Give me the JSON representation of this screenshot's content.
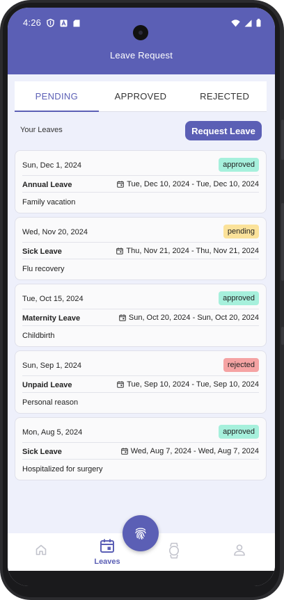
{
  "status_bar": {
    "time": "4:26",
    "left_icons": [
      "shield-icon",
      "a-box-icon",
      "sd-card-icon"
    ],
    "right_icons": [
      "wifi-icon",
      "signal-icon",
      "battery-icon"
    ]
  },
  "header": {
    "title": "Leave Request"
  },
  "tabs": [
    {
      "label": "PENDING",
      "active": true
    },
    {
      "label": "APPROVED",
      "active": false
    },
    {
      "label": "REJECTED",
      "active": false
    }
  ],
  "toolbar": {
    "section_label": "Your Leaves",
    "request_button": "Request Leave"
  },
  "status_colors": {
    "approved": "#a6f0dc",
    "pending": "#fbe29a",
    "rejected": "#f5a3a3"
  },
  "leaves": [
    {
      "date": "Sun, Dec 1, 2024",
      "status": "approved",
      "type": "Annual Leave",
      "range": "Tue, Dec 10, 2024 - Tue, Dec 10, 2024",
      "reason": "Family vacation"
    },
    {
      "date": "Wed, Nov 20, 2024",
      "status": "pending",
      "type": "Sick Leave",
      "range": "Thu, Nov 21, 2024 - Thu, Nov 21, 2024",
      "reason": "Flu recovery"
    },
    {
      "date": "Tue, Oct 15, 2024",
      "status": "approved",
      "type": "Maternity Leave",
      "range": "Sun, Oct 20, 2024 - Sun, Oct 20, 2024",
      "reason": "Childbirth"
    },
    {
      "date": "Sun, Sep 1, 2024",
      "status": "rejected",
      "type": "Unpaid Leave",
      "range": "Tue, Sep 10, 2024 - Tue, Sep 10, 2024",
      "reason": "Personal reason"
    },
    {
      "date": "Mon, Aug 5, 2024",
      "status": "approved",
      "type": "Sick Leave",
      "range": "Wed, Aug 7, 2024 - Wed, Aug 7, 2024",
      "reason": "Hospitalized for surgery"
    }
  ],
  "bottom_nav": {
    "items": [
      {
        "icon": "home-icon",
        "label": "",
        "active": false
      },
      {
        "icon": "calendar-icon",
        "label": "Leaves",
        "active": true
      },
      {
        "icon": "watch-icon",
        "label": "",
        "active": false
      },
      {
        "icon": "person-icon",
        "label": "",
        "active": false
      }
    ],
    "fab_icon": "fingerprint-icon"
  },
  "colors": {
    "primary": "#5b5fb5",
    "background": "#eef0fb"
  }
}
